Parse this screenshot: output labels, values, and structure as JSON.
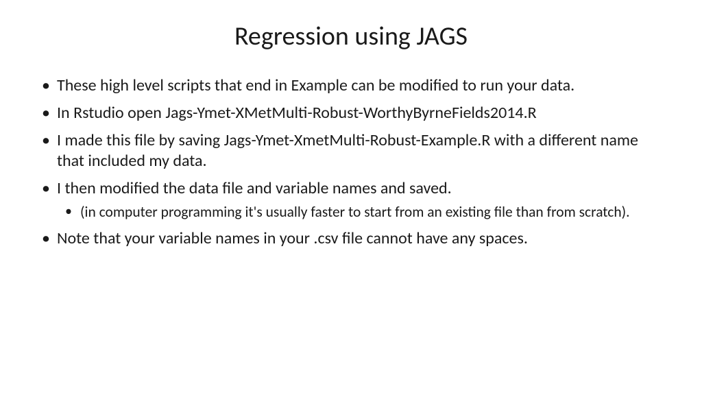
{
  "slide": {
    "title": "Regression using JAGS",
    "bullets": [
      {
        "text": "These high level scripts that end in Example can be modified to run your data."
      },
      {
        "text": "In Rstudio open Jags-Ymet-XMetMulti-Robust-WorthyByrneFields2014.R"
      },
      {
        "text": "I made this file by saving Jags-Ymet-XmetMulti-Robust-Example.R with a different name that included my data."
      },
      {
        "text": "I then modified the data file and variable names and saved.",
        "sub": [
          "(in computer programming it's usually faster to start from an existing file than from scratch)."
        ]
      },
      {
        "text": "Note that your variable names in your .csv file cannot have any spaces."
      }
    ]
  }
}
